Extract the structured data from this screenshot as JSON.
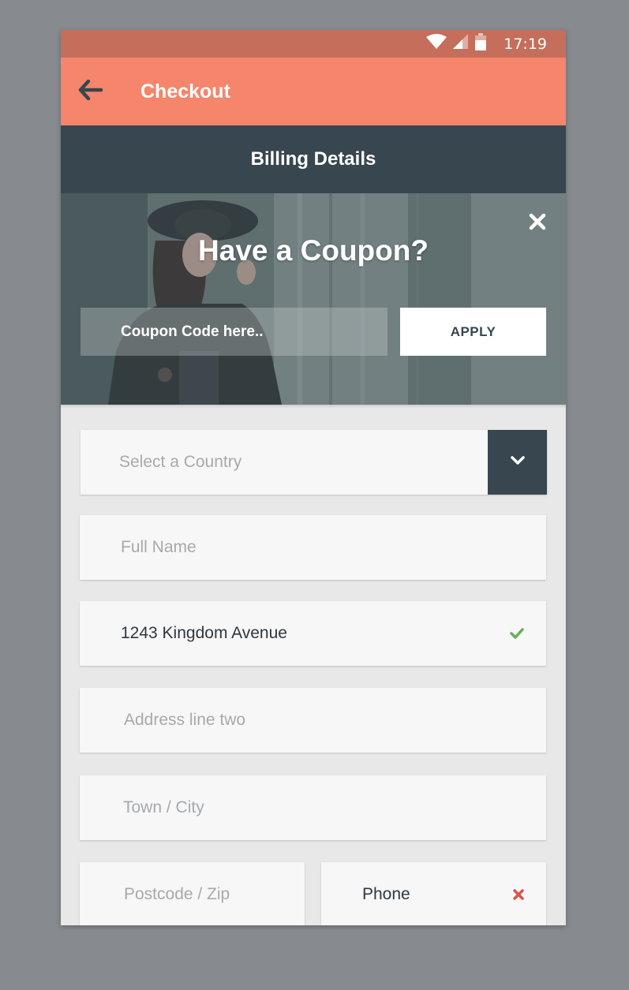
{
  "status_bar": {
    "time": "17:19",
    "icons": [
      "wifi-icon",
      "signal-icon",
      "battery-icon"
    ]
  },
  "app_bar": {
    "title": "Checkout",
    "back_icon": "arrow-left-icon"
  },
  "section": {
    "title": "Billing Details"
  },
  "coupon": {
    "title": "Have a Coupon?",
    "placeholder": "Coupon Code here..",
    "apply_label": "APPLY",
    "close_icon": "close-icon"
  },
  "form": {
    "country": {
      "placeholder": "Select a Country",
      "dropdown_icon": "chevron-down-icon"
    },
    "full_name": {
      "placeholder": "Full Name"
    },
    "address_one": {
      "value": "1243 Kingdom Avenue",
      "status": "valid",
      "status_icon": "check-icon"
    },
    "address_two": {
      "placeholder": "Address line two"
    },
    "town": {
      "placeholder": "Town / City"
    },
    "postcode": {
      "placeholder": "Postcode / Zip"
    },
    "phone": {
      "value": "Phone",
      "status": "invalid",
      "status_icon": "cross-icon"
    }
  },
  "colors": {
    "accent": "#f5856b",
    "status_bar": "#c56e5b",
    "dark": "#37464f",
    "valid": "#6cad5a",
    "invalid": "#d9534f"
  }
}
